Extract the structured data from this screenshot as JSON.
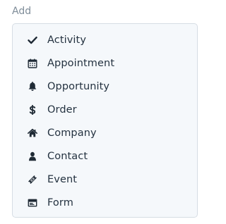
{
  "add_label": "Add",
  "menu": {
    "items": [
      {
        "label": "Activity",
        "icon": "check-icon"
      },
      {
        "label": "Appointment",
        "icon": "calendar-icon"
      },
      {
        "label": "Opportunity",
        "icon": "bell-icon"
      },
      {
        "label": "Order",
        "icon": "dollar-icon"
      },
      {
        "label": "Company",
        "icon": "home-icon"
      },
      {
        "label": "Contact",
        "icon": "user-icon"
      },
      {
        "label": "Event",
        "icon": "ticket-icon"
      },
      {
        "label": "Form",
        "icon": "form-icon"
      }
    ]
  }
}
